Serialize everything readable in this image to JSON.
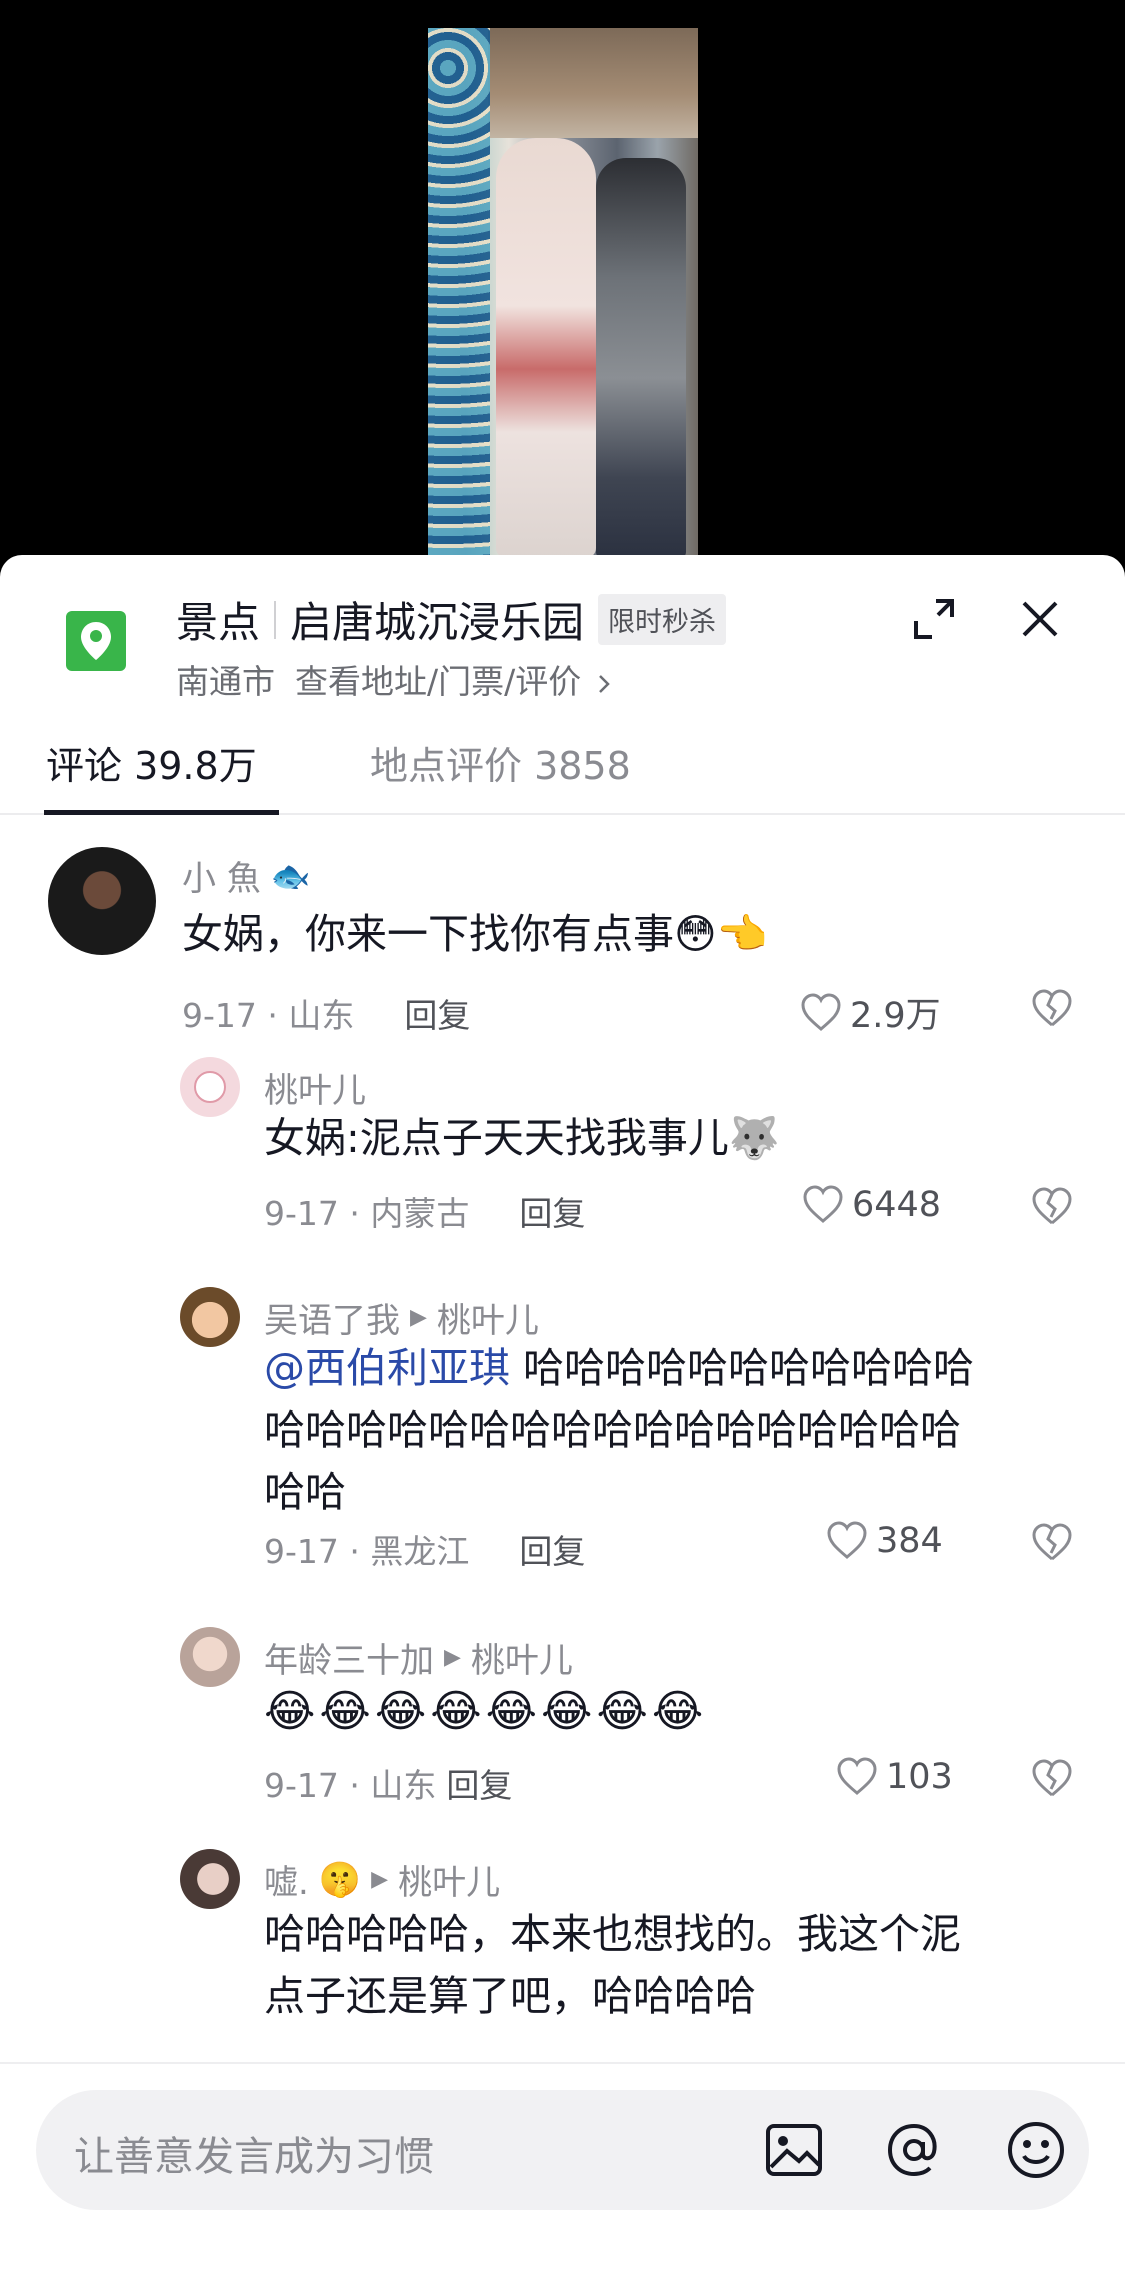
{
  "location": {
    "category": "景点",
    "name": "启唐城沉浸乐园",
    "badge": "限时秒杀",
    "city": "南通市",
    "link": "查看地址/门票/评价"
  },
  "tabs": [
    {
      "label": "评论 39.8万",
      "active": true
    },
    {
      "label": "地点评价 3858",
      "active": false
    }
  ],
  "comments": [
    {
      "name": "小 魚",
      "text": "女娲，你来一下找你有点事",
      "date": "9-17 · 山东",
      "reply": "回复",
      "likes": "2.9万",
      "level": "top"
    },
    {
      "name": "桃叶儿",
      "text": "女娲:泥点子天天找我事儿",
      "date": "9-17 · 内蒙古",
      "reply": "回复",
      "likes": "6448",
      "level": "reply"
    },
    {
      "name": "吴语了我",
      "reply_to": "桃叶儿",
      "mention": "@西伯利亚琪",
      "text_line1": " 哈哈哈哈哈哈哈哈哈哈哈",
      "text_line2": "哈哈哈哈哈哈哈哈哈哈哈哈哈哈哈哈哈",
      "text_line3": "哈哈",
      "date": "9-17 · 黑龙江",
      "reply": "回复",
      "likes": "384",
      "level": "reply"
    },
    {
      "name": "年龄三十加",
      "reply_to": "桃叶儿",
      "text": "😂😂😂😂😂😂😂😂",
      "date": "9-17 · 山东",
      "reply": "回复",
      "likes": "103",
      "level": "reply"
    },
    {
      "name": "嘘.",
      "reply_to": "桃叶儿",
      "text_line1": "哈哈哈哈哈，本来也想找的。我这个泥",
      "text_line2": "点子还是算了吧，哈哈哈哈",
      "level": "reply"
    }
  ],
  "input": {
    "placeholder": "让善意发言成为习惯"
  },
  "colors": {
    "accent_green": "#39b54a",
    "mention_blue": "#2a4aa8",
    "text_primary": "#161823",
    "text_secondary": "#8a8b91"
  }
}
